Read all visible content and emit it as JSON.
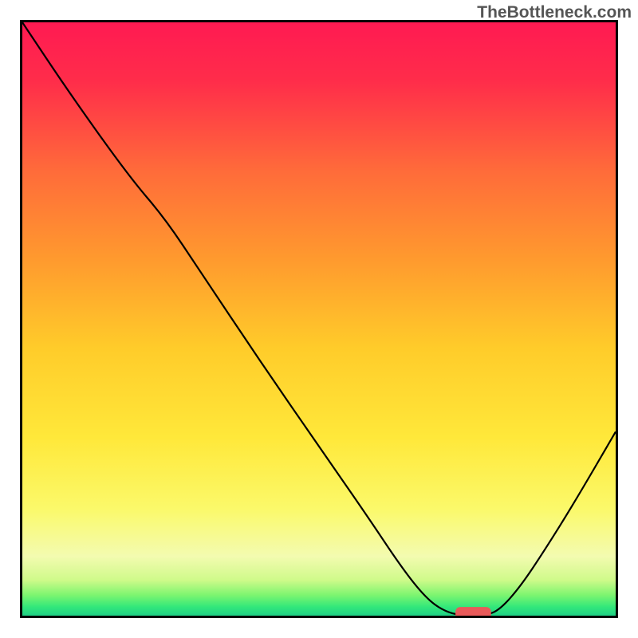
{
  "watermark": "TheBottleneck.com",
  "chart_data": {
    "type": "line",
    "title": "",
    "xlabel": "",
    "ylabel": "",
    "xlim": [
      0,
      100
    ],
    "ylim": [
      0,
      100
    ],
    "background_gradient": {
      "stops": [
        {
          "offset": 0.0,
          "color": "#ff1a52"
        },
        {
          "offset": 0.1,
          "color": "#ff2d4a"
        },
        {
          "offset": 0.25,
          "color": "#ff6b3a"
        },
        {
          "offset": 0.4,
          "color": "#ff9a2e"
        },
        {
          "offset": 0.55,
          "color": "#ffcc2a"
        },
        {
          "offset": 0.7,
          "color": "#ffe83a"
        },
        {
          "offset": 0.82,
          "color": "#fbf96a"
        },
        {
          "offset": 0.9,
          "color": "#f3fbb0"
        },
        {
          "offset": 0.94,
          "color": "#cffa8a"
        },
        {
          "offset": 0.965,
          "color": "#7ef570"
        },
        {
          "offset": 0.985,
          "color": "#33e87a"
        },
        {
          "offset": 1.0,
          "color": "#20d085"
        }
      ]
    },
    "series": [
      {
        "name": "bottleneck_curve",
        "color": "#000000",
        "width": 2.2,
        "points": [
          {
            "x": 0.0,
            "y": 100.0
          },
          {
            "x": 8.0,
            "y": 88.0
          },
          {
            "x": 18.0,
            "y": 74.0
          },
          {
            "x": 24.0,
            "y": 67.0
          },
          {
            "x": 30.0,
            "y": 58.0
          },
          {
            "x": 40.0,
            "y": 43.0
          },
          {
            "x": 50.0,
            "y": 28.5
          },
          {
            "x": 58.0,
            "y": 17.0
          },
          {
            "x": 64.0,
            "y": 8.0
          },
          {
            "x": 68.0,
            "y": 3.0
          },
          {
            "x": 71.0,
            "y": 0.8
          },
          {
            "x": 74.0,
            "y": 0.0
          },
          {
            "x": 78.0,
            "y": 0.0
          },
          {
            "x": 80.5,
            "y": 1.0
          },
          {
            "x": 84.0,
            "y": 5.0
          },
          {
            "x": 88.0,
            "y": 11.0
          },
          {
            "x": 93.0,
            "y": 19.0
          },
          {
            "x": 100.0,
            "y": 31.0
          }
        ]
      }
    ],
    "marker": {
      "name": "optimum_marker",
      "color": "#e85a5a",
      "x": 76.0,
      "y": 0.0,
      "width": 6.0,
      "height": 2.4
    }
  }
}
